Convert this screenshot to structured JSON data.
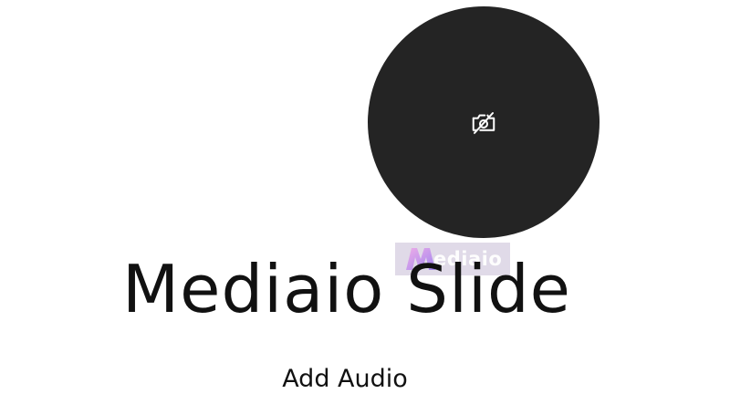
{
  "avatar": {
    "icon": "camera-off-icon",
    "background_color": "#242424",
    "icon_color": "#ffffff"
  },
  "watermark": {
    "brand_initial": "M",
    "brand_text": "ediaio"
  },
  "slide": {
    "title": "Mediaio Slide"
  },
  "actions": {
    "add_audio_label": "Add Audio"
  }
}
